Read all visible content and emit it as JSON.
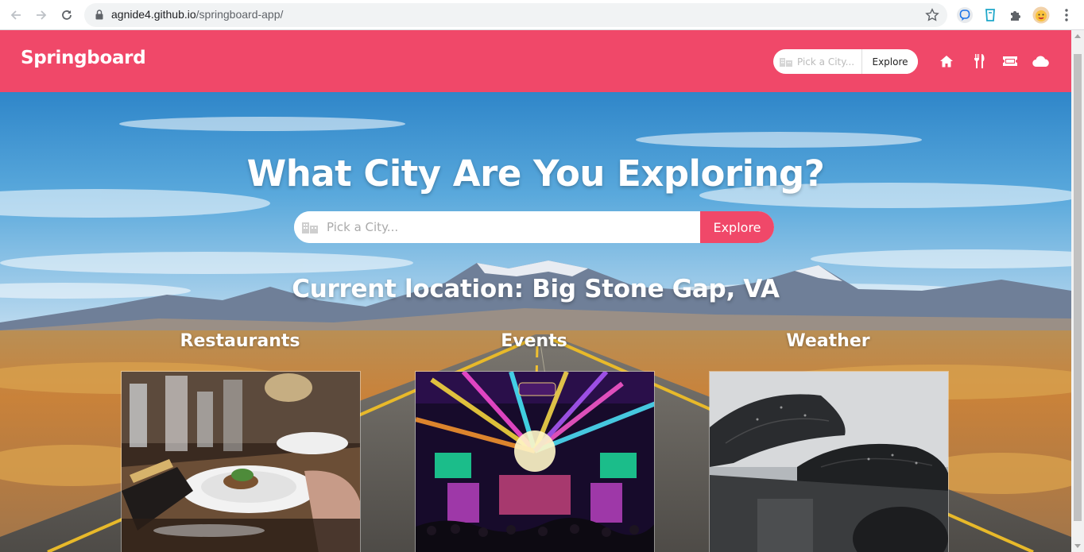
{
  "browser": {
    "url_host": "agnide4.github.io",
    "url_path": "/springboard-app/"
  },
  "header": {
    "brand": "Springboard",
    "search_placeholder": "Pick a City...",
    "search_button": "Explore",
    "nav_icons": [
      "home-icon",
      "utensils-icon",
      "ticket-icon",
      "cloud-icon"
    ]
  },
  "hero": {
    "title": "What City Are You Exploring?",
    "search_placeholder": "Pick a City...",
    "search_button": "Explore",
    "location_text": "Current location: Big Stone Gap, VA",
    "categories": [
      {
        "label": "Restaurants"
      },
      {
        "label": "Events"
      },
      {
        "label": "Weather"
      }
    ]
  },
  "colors": {
    "brand_pink": "#f04869",
    "white": "#ffffff"
  }
}
